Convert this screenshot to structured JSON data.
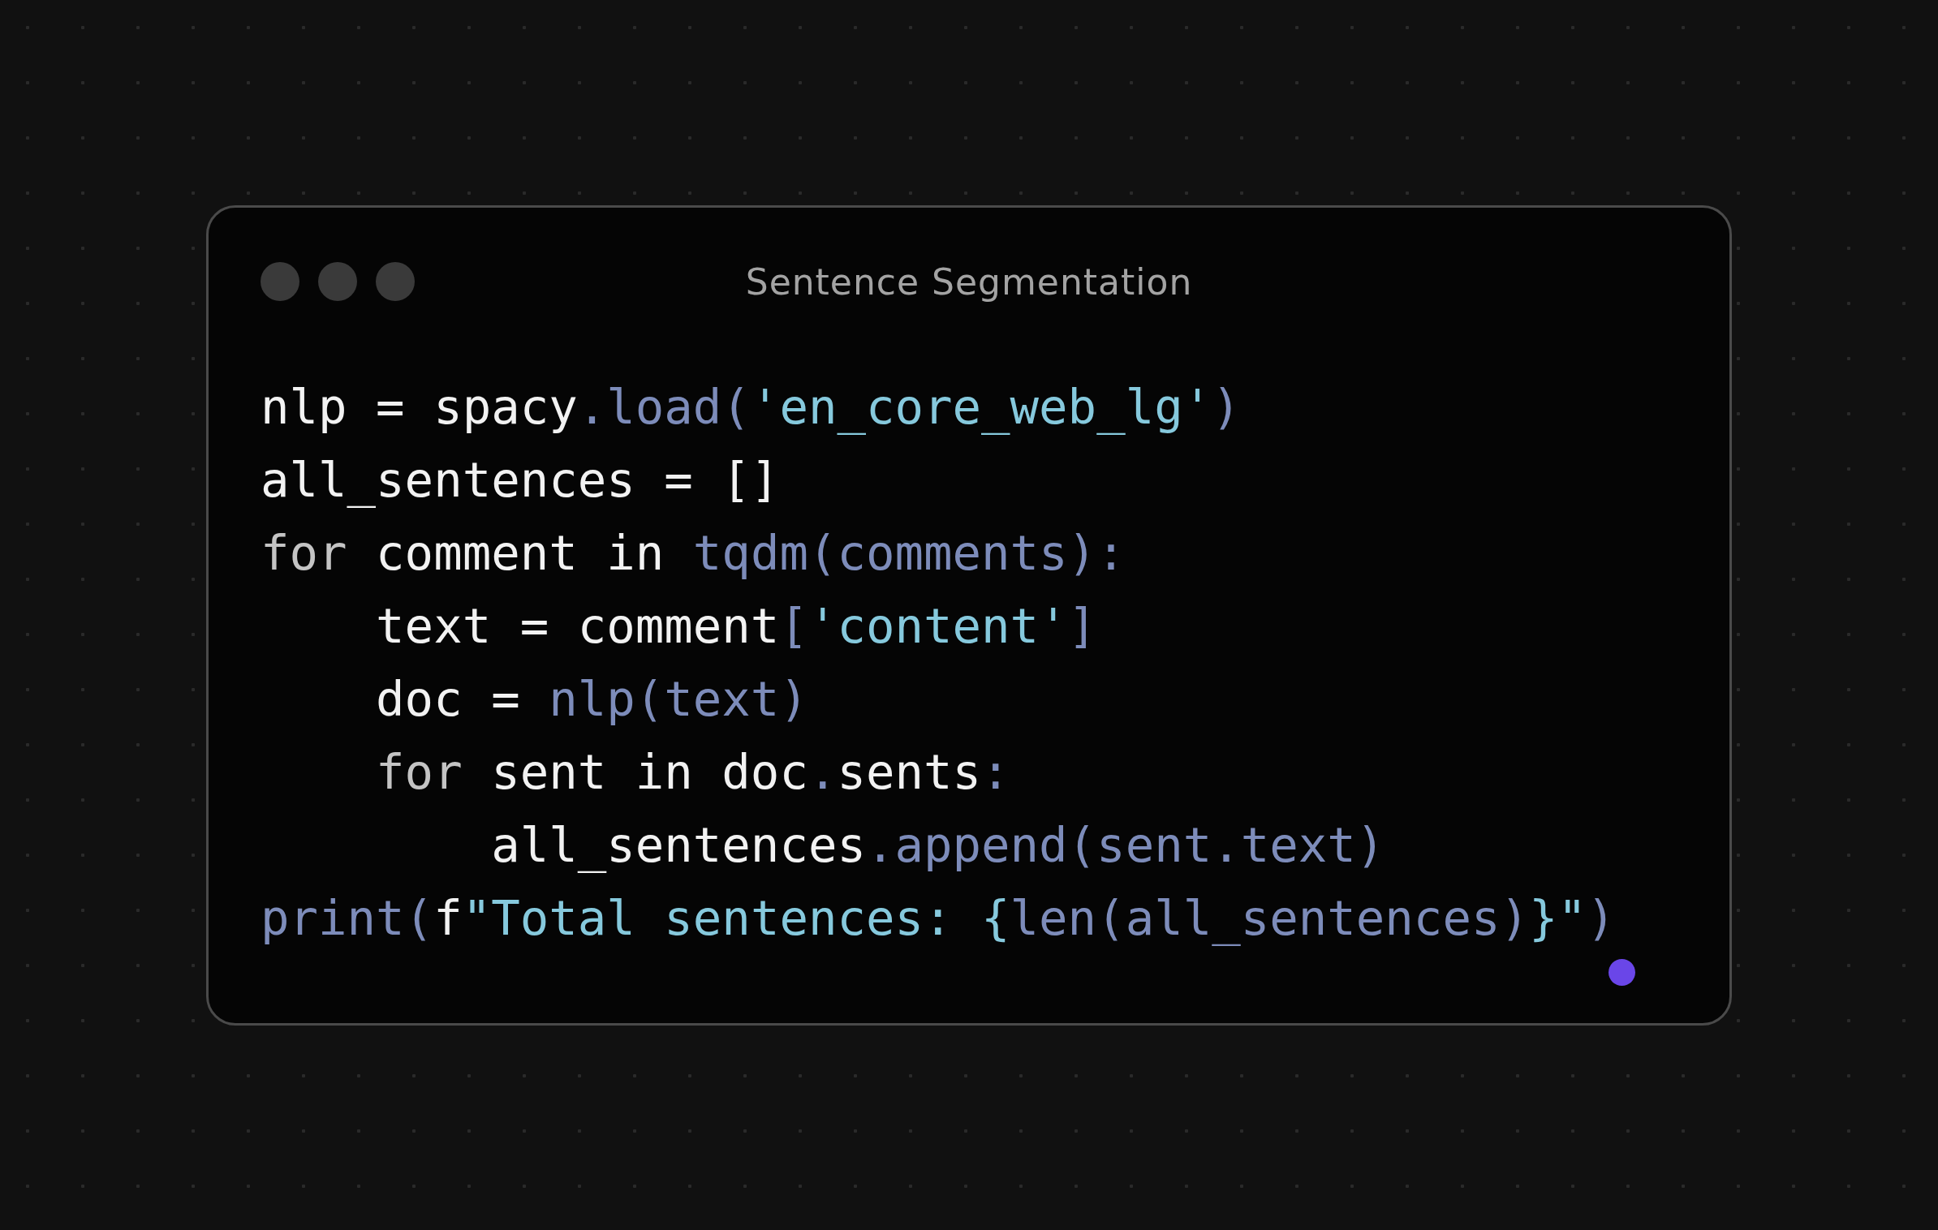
{
  "window": {
    "title": "Sentence Segmentation"
  },
  "code": {
    "lines": [
      {
        "tokens": [
          {
            "kind": "plain",
            "text": "nlp = spacy"
          },
          {
            "kind": "function",
            "text": ".load("
          },
          {
            "kind": "string",
            "text": "'en_core_web_lg'"
          },
          {
            "kind": "function",
            "text": ")"
          }
        ]
      },
      {
        "tokens": [
          {
            "kind": "plain",
            "text": "all_sentences = []"
          }
        ]
      },
      {
        "tokens": [
          {
            "kind": "keyword",
            "text": "for"
          },
          {
            "kind": "plain",
            "text": " comment in "
          },
          {
            "kind": "function",
            "text": "tqdm(comments):"
          }
        ]
      },
      {
        "tokens": [
          {
            "kind": "plain",
            "text": "    text = comment"
          },
          {
            "kind": "function",
            "text": "["
          },
          {
            "kind": "string",
            "text": "'content'"
          },
          {
            "kind": "function",
            "text": "]"
          }
        ]
      },
      {
        "tokens": [
          {
            "kind": "plain",
            "text": "    doc = "
          },
          {
            "kind": "function",
            "text": "nlp(text)"
          }
        ]
      },
      {
        "tokens": [
          {
            "kind": "keyword",
            "text": "    for"
          },
          {
            "kind": "plain",
            "text": " sent in doc"
          },
          {
            "kind": "function",
            "text": "."
          },
          {
            "kind": "plain",
            "text": "sents"
          },
          {
            "kind": "function",
            "text": ":"
          }
        ]
      },
      {
        "tokens": [
          {
            "kind": "plain",
            "text": "        all_sentences"
          },
          {
            "kind": "function",
            "text": ".append(sent.text)"
          }
        ]
      },
      {
        "tokens": [
          {
            "kind": "function",
            "text": "print("
          },
          {
            "kind": "plain",
            "text": "f"
          },
          {
            "kind": "string",
            "text": "\"Total sentences: {"
          },
          {
            "kind": "function",
            "text": "len(all_sentences)"
          },
          {
            "kind": "string",
            "text": "}\""
          },
          {
            "kind": "function",
            "text": ")"
          }
        ]
      }
    ]
  }
}
